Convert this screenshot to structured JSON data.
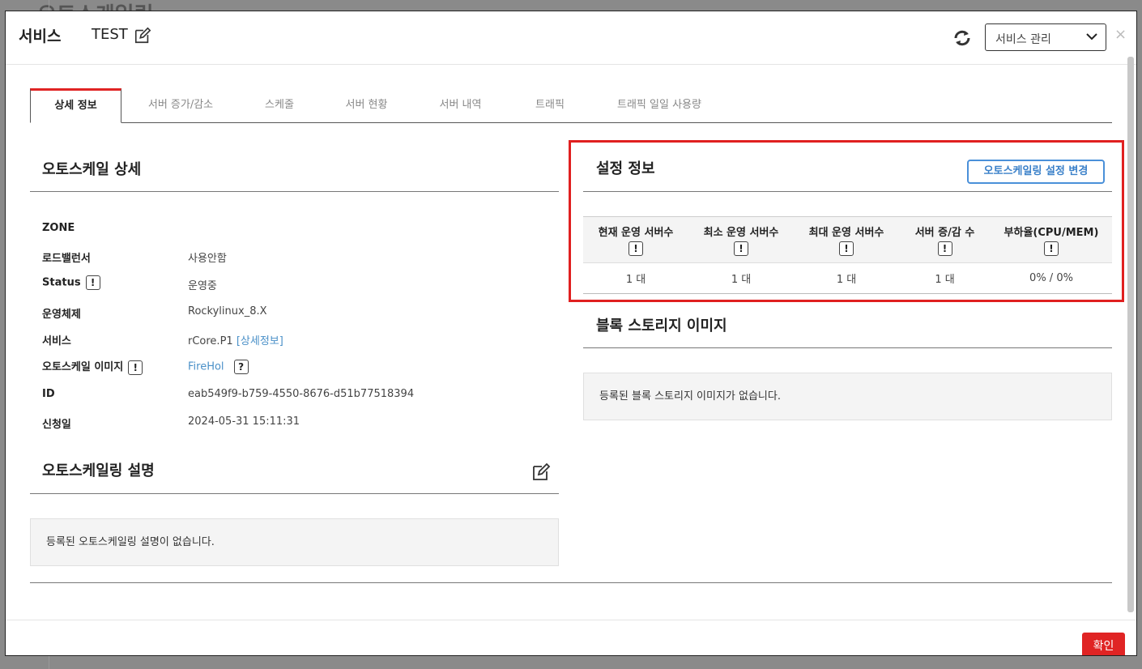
{
  "background": {
    "title": "오토스케일링"
  },
  "header": {
    "title": "서비스",
    "name": "TEST",
    "select_value": "서비스 관리",
    "close": "×"
  },
  "tabs": [
    {
      "label": "상세 정보",
      "active": true
    },
    {
      "label": "서버 증가/감소"
    },
    {
      "label": "스케줄"
    },
    {
      "label": "서버 현황"
    },
    {
      "label": "서버 내역"
    },
    {
      "label": "트래픽"
    },
    {
      "label": "트래픽 일일 사용량"
    }
  ],
  "details": {
    "title": "오토스케일 상세",
    "rows": [
      {
        "label": "ZONE",
        "value": ""
      },
      {
        "label": "로드밸런서",
        "value": "사용안함"
      },
      {
        "label": "Status",
        "value": "운영중"
      },
      {
        "label": "운영체제",
        "value": "Rockylinux_8.X"
      },
      {
        "label": "서비스",
        "value": "rCore.P1",
        "link": "[상세정보]"
      },
      {
        "label": "오토스케일 이미지",
        "link": "FireHol"
      },
      {
        "label": "ID",
        "value": "eab549f9-b759-4550-8676-d51b77518394"
      },
      {
        "label": "신청일",
        "value": "2024-05-31 15:11:31"
      }
    ],
    "badge_mark": "!",
    "help_mark": "?"
  },
  "description": {
    "title": "오토스케일링 설명",
    "empty": "등록된 오토스케일링 설명이 없습니다."
  },
  "settings": {
    "title": "설정 정보",
    "change_button": "오토스케일링 설정 변경",
    "columns": [
      "현재 운영 서버수",
      "최소 운영 서버수",
      "최대 운영 서버수",
      "서버 증/감 수",
      "부하율(CPU/MEM)"
    ],
    "values": [
      "1 대",
      "1 대",
      "1 대",
      "1 대",
      "0% / 0%"
    ]
  },
  "storage": {
    "title": "블록 스토리지 이미지",
    "empty": "등록된 블록 스토리지 이미지가 없습니다."
  },
  "footer": {
    "ok": "확인"
  },
  "colors": {
    "accent": "#e02424",
    "link": "#4a90c8",
    "button_outline": "#4a90d9"
  }
}
